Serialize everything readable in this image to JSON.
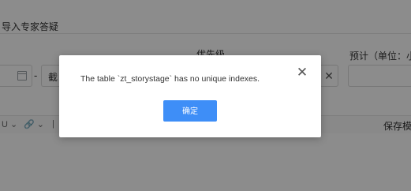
{
  "background": {
    "assign_hint": "导入专家答疑",
    "priority_label": "优先级",
    "estimate_label": "预计（单位：小",
    "date_separator": "-",
    "date_end_text": "截",
    "clear_glyph": "✕",
    "toolbar_items": [
      "U ⌄",
      "🔗 ⌄",
      "|"
    ],
    "save_template_label": "保存模板"
  },
  "dialog": {
    "message": "The table `zt_storystage` has no unique indexes.",
    "close_glyph": "✕",
    "confirm_label": "确定",
    "confirm_color": "#3e8ef7"
  }
}
